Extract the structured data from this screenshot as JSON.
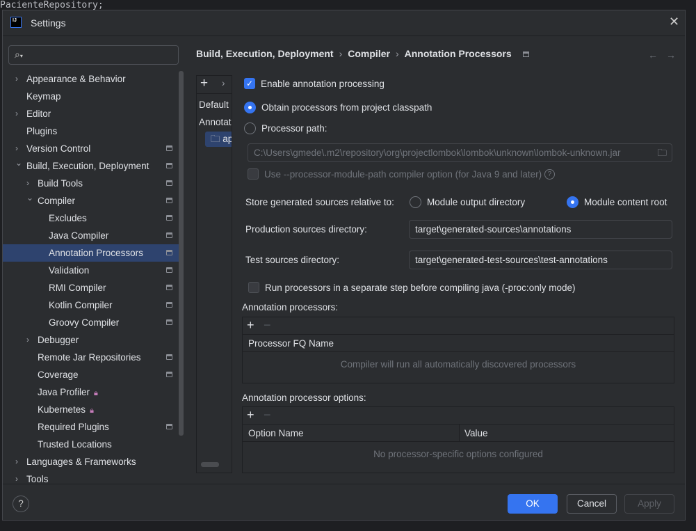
{
  "background_code": "PacienteRepository;",
  "window": {
    "title": "Settings",
    "logo_text": "IJ"
  },
  "search": {
    "placeholder": ""
  },
  "tree": [
    {
      "label": "Appearance & Behavior",
      "level": 0,
      "arrow": "collapsed"
    },
    {
      "label": "Keymap",
      "level": 0
    },
    {
      "label": "Editor",
      "level": 0,
      "arrow": "collapsed"
    },
    {
      "label": "Plugins",
      "level": 0
    },
    {
      "label": "Version Control",
      "level": 0,
      "arrow": "collapsed",
      "badge": "pin"
    },
    {
      "label": "Build, Execution, Deployment",
      "level": 0,
      "arrow": "expanded",
      "badge": "pin"
    },
    {
      "label": "Build Tools",
      "level": 1,
      "arrow": "collapsed",
      "badge": "pin"
    },
    {
      "label": "Compiler",
      "level": 1,
      "arrow": "expanded",
      "badge": "pin"
    },
    {
      "label": "Excludes",
      "level": 2,
      "badge": "pin"
    },
    {
      "label": "Java Compiler",
      "level": 2,
      "badge": "pin"
    },
    {
      "label": "Annotation Processors",
      "level": 2,
      "badge": "pin",
      "selected": true
    },
    {
      "label": "Validation",
      "level": 2,
      "badge": "pin"
    },
    {
      "label": "RMI Compiler",
      "level": 2,
      "badge": "pin"
    },
    {
      "label": "Kotlin Compiler",
      "level": 2,
      "badge": "pin"
    },
    {
      "label": "Groovy Compiler",
      "level": 2,
      "badge": "pin"
    },
    {
      "label": "Debugger",
      "level": 1,
      "arrow": "collapsed"
    },
    {
      "label": "Remote Jar Repositories",
      "level": 1,
      "badge": "pin"
    },
    {
      "label": "Coverage",
      "level": 1,
      "badge": "pin"
    },
    {
      "label": "Java Profiler",
      "level": 1,
      "badge": "lock"
    },
    {
      "label": "Kubernetes",
      "level": 1,
      "badge": "lock"
    },
    {
      "label": "Required Plugins",
      "level": 1,
      "badge": "pin"
    },
    {
      "label": "Trusted Locations",
      "level": 1
    },
    {
      "label": "Languages & Frameworks",
      "level": 0,
      "arrow": "collapsed"
    },
    {
      "label": "Tools",
      "level": 0,
      "arrow": "collapsed"
    }
  ],
  "breadcrumb": [
    "Build, Execution, Deployment",
    "Compiler",
    "Annotation Processors"
  ],
  "profiles": {
    "items": [
      "Default",
      "Annotat",
      "ap"
    ]
  },
  "settings": {
    "enable_label": "Enable annotation processing",
    "enable_checked": true,
    "obtain_label": "Obtain processors from project classpath",
    "path_label": "Processor path:",
    "processor_path_mode": "project classpath",
    "path_value": "C:\\Users\\gmede\\.m2\\repository\\org\\projectlombok\\lombok\\unknown\\lombok-unknown.jar",
    "module_path_label": "Use --processor-module-path compiler option (for Java 9 and later)",
    "store_label": "Store generated sources relative to:",
    "store_opt1": "Module output directory",
    "store_opt2": "Module content root",
    "store_selected": "Module content root",
    "prod_label": "Production sources directory:",
    "prod_value": "target\\generated-sources\\annotations",
    "test_label": "Test sources directory:",
    "test_value": "target\\generated-test-sources\\test-annotations",
    "separate_label": "Run processors in a separate step before compiling java (-proc:only mode)",
    "separate_checked": false
  },
  "processors": {
    "title": "Annotation processors:",
    "column": "Processor FQ Name",
    "empty": "Compiler will run all automatically discovered processors"
  },
  "options": {
    "title": "Annotation processor options:",
    "columns": [
      "Option Name",
      "Value"
    ],
    "empty": "No processor-specific options configured"
  },
  "footer": {
    "help": "?",
    "ok": "OK",
    "cancel": "Cancel",
    "apply": "Apply"
  },
  "colors": {
    "accent": "#3574f0",
    "dialog_bg": "#2b2d30",
    "selection": "#2e436e"
  }
}
